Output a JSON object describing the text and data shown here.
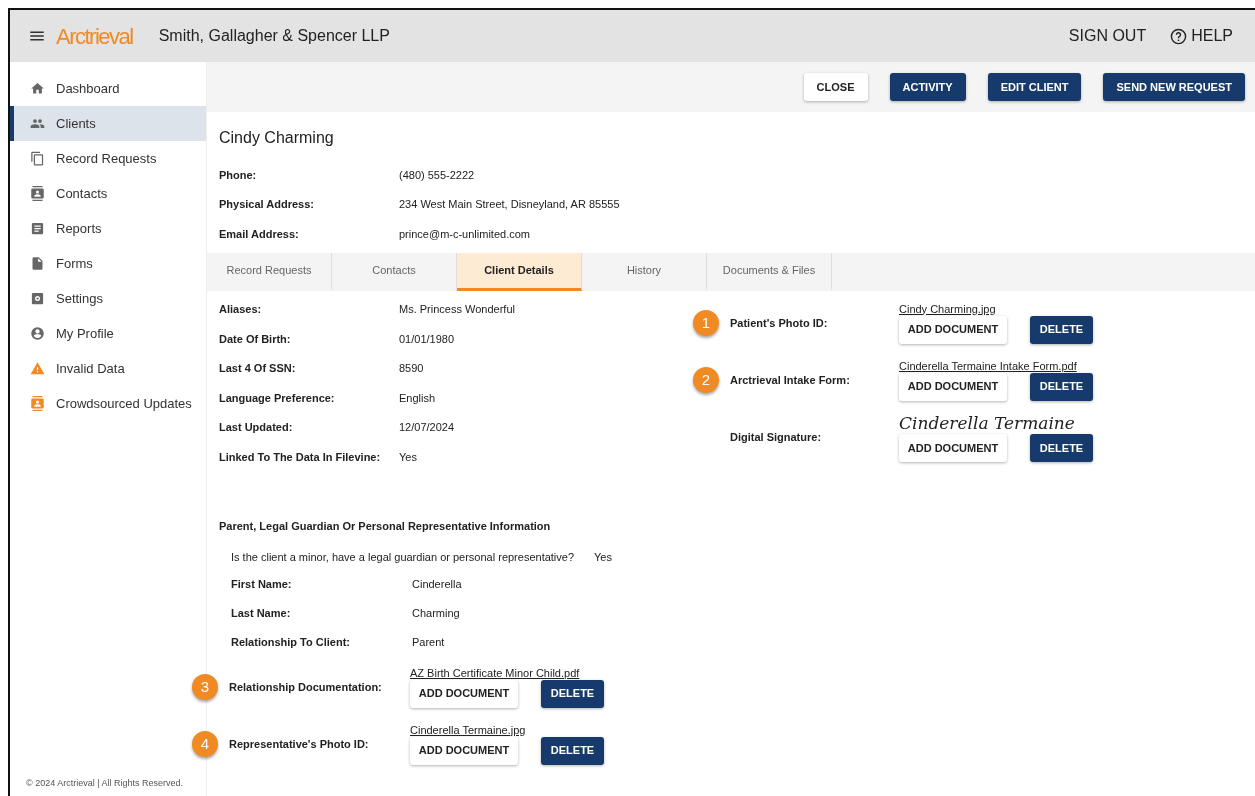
{
  "header": {
    "logo": "Arctrieval",
    "firm": "Smith, Gallagher & Spencer LLP",
    "actions": [
      "SIGN OUT",
      "HELP"
    ]
  },
  "sidebar": {
    "items": [
      {
        "label": "Dashboard",
        "selected": false
      },
      {
        "label": "Clients",
        "selected": true
      },
      {
        "label": "Record Requests",
        "selected": false
      },
      {
        "label": "Contacts",
        "selected": false
      },
      {
        "label": "Reports",
        "selected": false
      },
      {
        "label": "Forms",
        "selected": false
      },
      {
        "label": "Settings",
        "selected": false
      },
      {
        "label": "My Profile",
        "selected": false
      },
      {
        "label": "Invalid Data",
        "selected": false
      },
      {
        "label": "Crowdsourced Updates",
        "selected": false
      }
    ],
    "footer": "© 2024 Arctrieval | All Rights Reserved."
  },
  "toolbar": [
    {
      "label": "CLOSE",
      "kind": "secondary"
    },
    {
      "label": "ACTIVITY",
      "kind": "primary"
    },
    {
      "label": "EDIT CLIENT",
      "kind": "primary"
    },
    {
      "label": "SEND NEW REQUEST",
      "kind": "primary"
    }
  ],
  "client": {
    "name": "Cindy Charming",
    "fields": [
      {
        "label": "Phone:",
        "value": "(480) 555-2222"
      },
      {
        "label": "Physical Address:",
        "value": "234 West Main Street, Disneyland, AR 85555"
      },
      {
        "label": "Email Address:",
        "value": "prince@m-c-unlimited.com"
      }
    ]
  },
  "tabs": [
    {
      "label": "Record Requests",
      "selected": false
    },
    {
      "label": "Contacts",
      "selected": false
    },
    {
      "label": "Client Details",
      "selected": true
    },
    {
      "label": "History",
      "selected": false
    },
    {
      "label": "Documents & Files",
      "selected": false
    }
  ],
  "details": [
    {
      "label": "Aliases:",
      "value": "Ms. Princess Wonderful"
    },
    {
      "label": "Date Of Birth:",
      "value": "01/01/1980"
    },
    {
      "label": "Last 4 Of SSN:",
      "value": "8590"
    },
    {
      "label": "Language Preference:",
      "value": "English"
    },
    {
      "label": "Last Updated:",
      "value": "12/07/2024"
    },
    {
      "label": "Linked To The Data In Filevine:",
      "value": "Yes"
    }
  ],
  "documents": [
    {
      "badge": "1",
      "label": "Patient's Photo ID:",
      "kind": "file",
      "file": "Cindy Charming.jpg",
      "buttons": [
        "ADD DOCUMENT",
        "DELETE"
      ]
    },
    {
      "badge": "2",
      "label": "Arctrieval Intake Form:",
      "kind": "file",
      "file": "Cinderella Termaine Intake Form.pdf",
      "buttons": [
        "ADD DOCUMENT",
        "DELETE"
      ]
    },
    {
      "label": "Digital Signature:",
      "kind": "signature",
      "signature": "Cinderella Termaine",
      "buttons": [
        "ADD DOCUMENT",
        "DELETE"
      ]
    }
  ],
  "guardian": {
    "title": "Parent, Legal Guardian Or Personal Representative Information",
    "question": "Is the client a minor, have a legal guardian or personal representative?",
    "answer": "Yes",
    "fields": [
      {
        "label": "First Name:",
        "value": "Cinderella"
      },
      {
        "label": "Last Name:",
        "value": "Charming"
      },
      {
        "label": "Relationship To Client:",
        "value": "Parent"
      }
    ],
    "documents": [
      {
        "badge": "3",
        "label": "Relationship Documentation:",
        "kind": "file",
        "file": "AZ Birth Certificate Minor Child.pdf",
        "buttons": [
          "ADD DOCUMENT",
          "DELETE"
        ]
      },
      {
        "badge": "4",
        "label": "Representative's Photo ID:",
        "kind": "file",
        "file": "Cinderella Termaine.jpg",
        "buttons": [
          "ADD DOCUMENT",
          "DELETE"
        ]
      }
    ]
  }
}
